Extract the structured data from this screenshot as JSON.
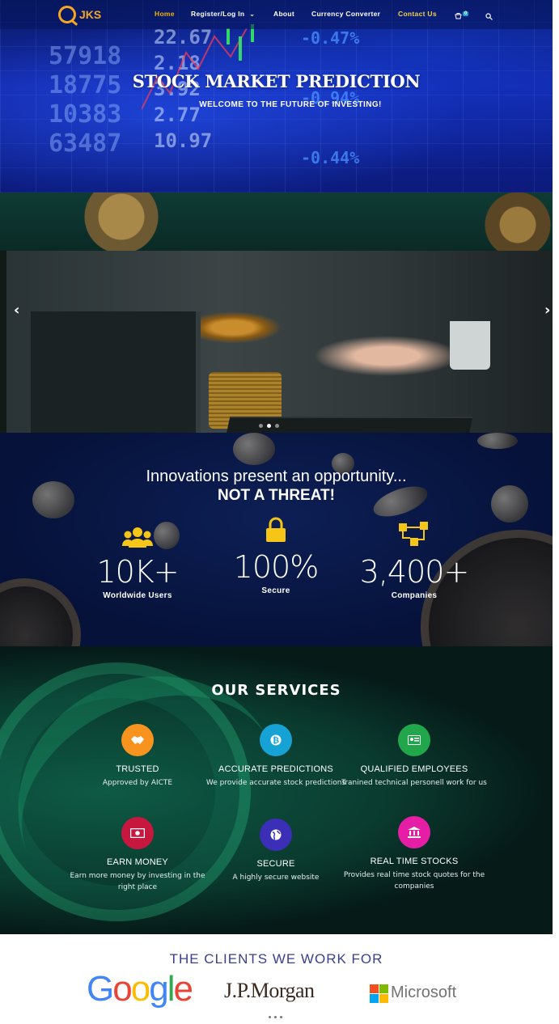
{
  "nav": {
    "logo_text": "JKS",
    "items": [
      {
        "label": "Home"
      },
      {
        "label": "Register/Log In"
      },
      {
        "label": "About"
      },
      {
        "label": "Currency Converter"
      },
      {
        "label": "Contact Us"
      }
    ],
    "cart_count": "0",
    "active_color": "#f5b400"
  },
  "hero": {
    "title": "STOCK MARKET PREDICTION",
    "subtitle": "WELCOME TO THE FUTURE OF INVESTING!",
    "ticker_left": "57918\n18775\n10383\n63487",
    "ticker_mid": "22.67\n2.18\n3.92\n2.77\n10.97",
    "ticker_right": "-0.47%\n-0.94%\n-0.44%"
  },
  "carousel": {
    "prev_label": "‹",
    "next_label": "›",
    "slide_count": 3,
    "active_slide": 1
  },
  "stats": {
    "heading": "Innovations present an opportunity...",
    "heading_bold": "NOT A THREAT!",
    "items": [
      {
        "value": "10K+",
        "label": "Worldwide Users",
        "icon": "users-icon"
      },
      {
        "value": "100%",
        "label": "Secure",
        "icon": "lock-icon"
      },
      {
        "value": "3,400+",
        "label": "Companies",
        "icon": "network-icon"
      }
    ]
  },
  "services": {
    "title": "OUR SERVICES",
    "items": [
      {
        "name": "TRUSTED",
        "desc": "Approved by AICTE",
        "icon": "handshake-icon",
        "color": "#f7931e"
      },
      {
        "name": "ACCURATE PREDICTIONS",
        "desc": "We provide accurate stock predictions",
        "icon": "bitcoin-icon",
        "color": "#17a2d6"
      },
      {
        "name": "QUALIFIED EMPLOYEES",
        "desc": "Tranined technical personell work for us",
        "icon": "id-card-icon",
        "color": "#21a64b"
      },
      {
        "name": "EARN MONEY",
        "desc": "Earn more money by investing in the right place",
        "icon": "money-icon",
        "color": "#c8173f"
      },
      {
        "name": "SECURE",
        "desc": "A highly secure website",
        "icon": "globe-icon",
        "color": "#3b2fb8"
      },
      {
        "name": "REAL TIME STOCKS",
        "desc": "Provides real time stock quotes for the companies",
        "icon": "bank-icon",
        "color": "#e61ea5"
      }
    ]
  },
  "clients": {
    "title": "THE CLIENTS WE WORK FOR",
    "logos": [
      "Google",
      "J.P.Morgan",
      "Microsoft"
    ],
    "google_letters": [
      {
        "ch": "G",
        "color": "#4285f4"
      },
      {
        "ch": "o",
        "color": "#ea4335"
      },
      {
        "ch": "o",
        "color": "#fbbc05"
      },
      {
        "ch": "g",
        "color": "#4285f4"
      },
      {
        "ch": "l",
        "color": "#34a853"
      },
      {
        "ch": "e",
        "color": "#ea4335"
      }
    ],
    "ms_colors": [
      "#f25022",
      "#7fba00",
      "#00a4ef",
      "#ffb900"
    ]
  }
}
